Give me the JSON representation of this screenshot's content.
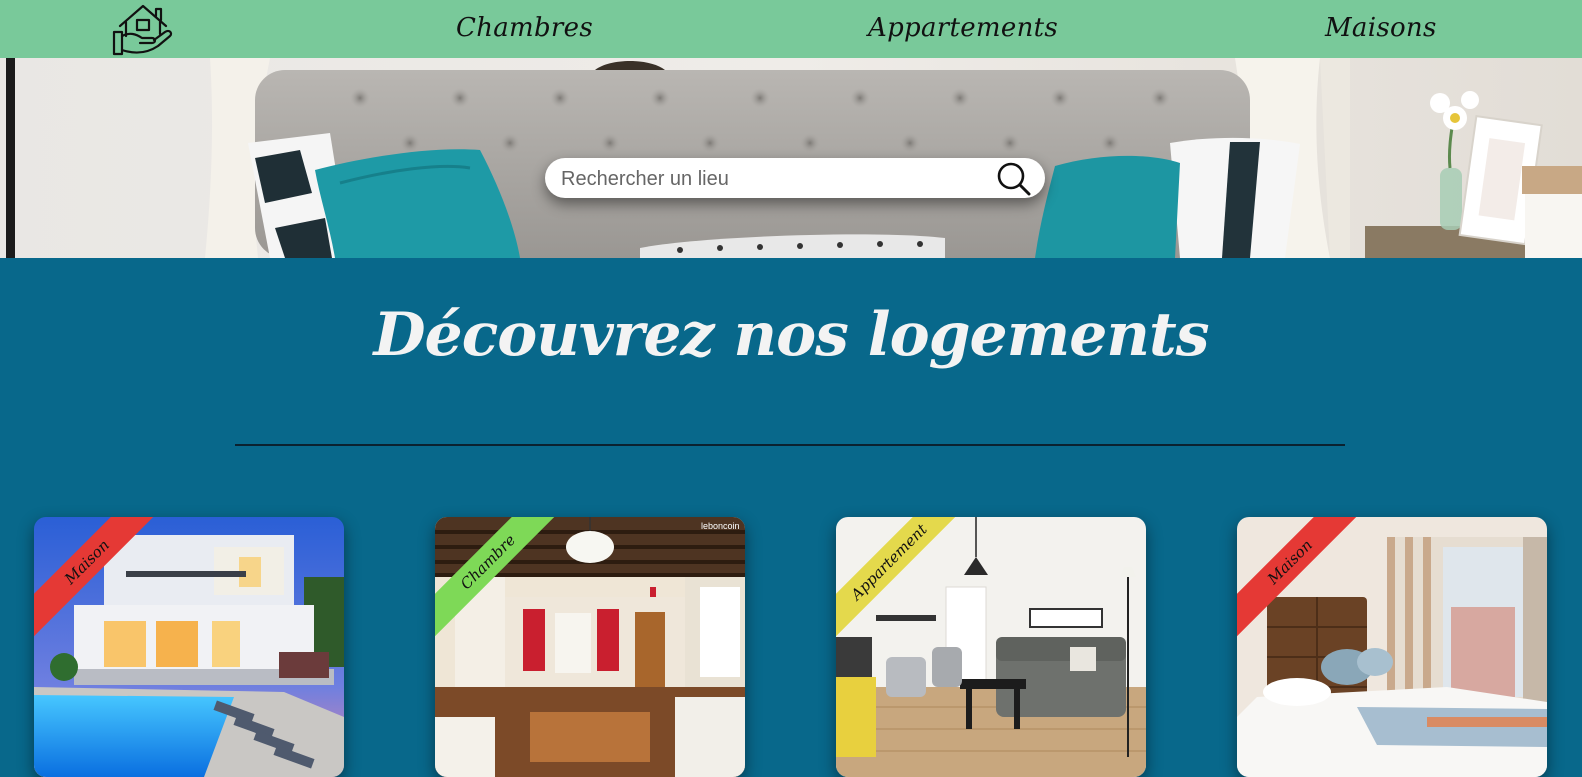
{
  "nav": {
    "links": [
      {
        "label": "Chambres"
      },
      {
        "label": "Appartements"
      },
      {
        "label": "Maisons"
      }
    ]
  },
  "search": {
    "placeholder": "Rechercher un lieu"
  },
  "section": {
    "title": "Découvrez nos logements"
  },
  "cards": [
    {
      "tag": "Maison",
      "tag_color": "#e53935"
    },
    {
      "tag": "Chambre",
      "tag_color": "#7ed957"
    },
    {
      "tag": "Appartement",
      "tag_color": "#e4d94c"
    },
    {
      "tag": "Maison",
      "tag_color": "#e53935"
    }
  ],
  "card2_watermark": "leboncoin",
  "colors": {
    "nav_bg": "#79c99a",
    "page_bg": "#08688b"
  }
}
